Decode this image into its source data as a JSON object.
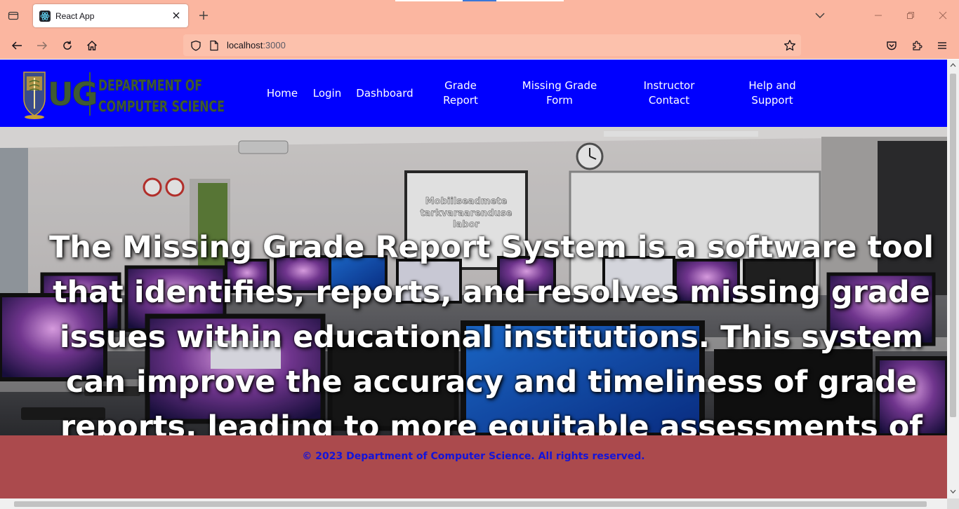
{
  "browser": {
    "tab_title": "React App",
    "url_host": "localhost",
    "url_port": ":3000"
  },
  "colors": {
    "header_bg": "#0000ff",
    "footer_bg": "#ab4a4d",
    "footer_text": "#1414d9",
    "chrome_bg": "#fbb6a0"
  },
  "logo": {
    "text_main": "UG",
    "text_line1": "DEPARTMENT OF",
    "text_line2": "COMPUTER SCIENCE"
  },
  "nav": {
    "home": "Home",
    "login": "Login",
    "dashboard": "Dashboard",
    "grade_report_1": "Grade",
    "grade_report_2": "Report",
    "missing_grade_1": "Missing Grade",
    "missing_grade_2": "Form",
    "instructor_1": "Instructor",
    "instructor_2": "Contact",
    "help_1": "Help and",
    "help_2": "Support"
  },
  "hero": {
    "projector_line1": "Mobiilseadmete",
    "projector_line2": "tarkvaraarenduse",
    "projector_line3": "labor",
    "text": "The Missing Grade Report System is a software tool that identifies, reports, and resolves missing grade issues within educational institutions. This system can improve the accuracy and timeliness of grade reports, leading to more equitable assessments of students' performance."
  },
  "footer": {
    "text": "© 2023 Department of Computer Science. All rights reserved."
  }
}
